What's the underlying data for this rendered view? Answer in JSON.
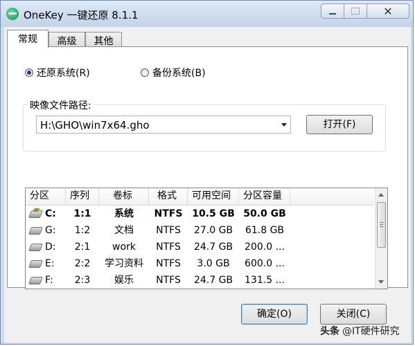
{
  "window": {
    "title": "OneKey 一键还原 8.1.1",
    "close_glyph": "✕"
  },
  "tabs": [
    {
      "label": "常规",
      "active": true
    },
    {
      "label": "高级",
      "active": false
    },
    {
      "label": "其他",
      "active": false
    }
  ],
  "mode": {
    "restore_label": "还原系统(R)",
    "backup_label": "备份系统(B)",
    "selected": "restore"
  },
  "image_path": {
    "legend": "映像文件路径:",
    "value": "H:\\GHO\\win7x64.gho",
    "open_button": "打开(F)"
  },
  "partitions": {
    "columns": [
      "分区",
      "序列",
      "卷标",
      "格式",
      "可用空间",
      "分区容量"
    ],
    "rows": [
      {
        "part": "C:",
        "seq": "1:1",
        "label": "系统",
        "fmt": "NTFS",
        "free": "10.5 GB",
        "size": "50.0 GB",
        "system": true
      },
      {
        "part": "G:",
        "seq": "1:2",
        "label": "文档",
        "fmt": "NTFS",
        "free": "27.0 GB",
        "size": "61.8 GB",
        "system": false
      },
      {
        "part": "D:",
        "seq": "2:1",
        "label": "work",
        "fmt": "NTFS",
        "free": "24.7 GB",
        "size": "200.0 ...",
        "system": false
      },
      {
        "part": "E:",
        "seq": "2:2",
        "label": "学习资料",
        "fmt": "NTFS",
        "free": "3.0 GB",
        "size": "600.0 ...",
        "system": false
      },
      {
        "part": "F:",
        "seq": "2:3",
        "label": "娱乐",
        "fmt": "NTFS",
        "free": "24.7 GB",
        "size": "131.5 ...",
        "system": false
      }
    ]
  },
  "buttons": {
    "ok": "确定(O)",
    "close": "关闭(C)"
  },
  "watermark": {
    "logo": "头条",
    "text": "@IT硬件研究"
  }
}
